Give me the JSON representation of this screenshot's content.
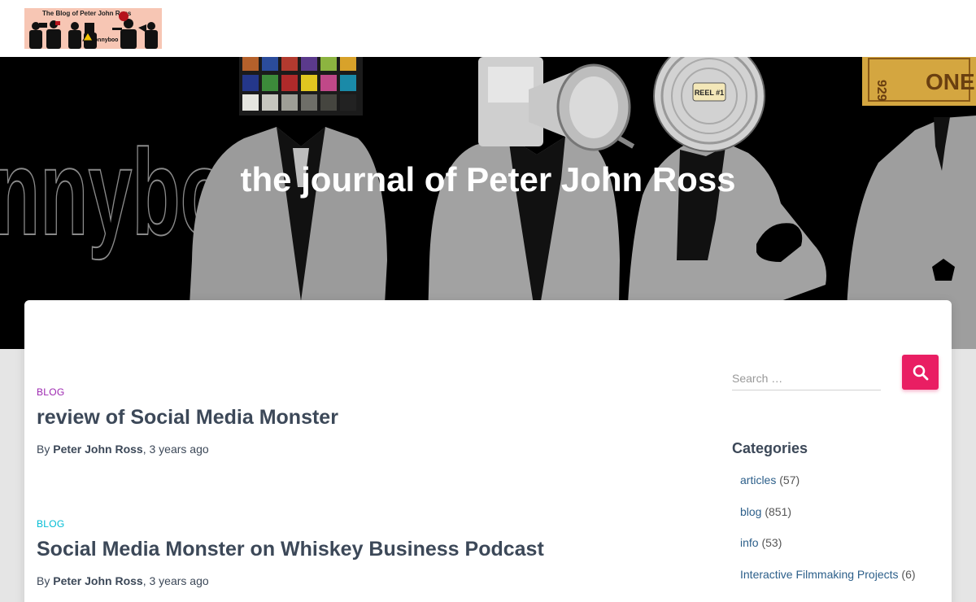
{
  "header": {
    "logo_text": "The Blog of Peter John Ross",
    "logo_badge": "sonnyboo"
  },
  "hero": {
    "title": "the journal of Peter John Ross",
    "bg_word": "nnyboo",
    "reel_label": "REEL #1",
    "ticket_number": "929",
    "ticket_word": "ONE"
  },
  "posts": [
    {
      "category": "BLOG",
      "category_color": "#9c27b0",
      "title": "review of Social Media Monster",
      "by": "By",
      "author": "Peter John Ross",
      "time": ", 3 years ago"
    },
    {
      "category": "BLOG",
      "category_color": "#00bcd4",
      "title": "Social Media Monster on Whiskey Business Podcast",
      "by": "By",
      "author": "Peter John Ross",
      "time": ", 3 years ago"
    }
  ],
  "sidebar": {
    "search": {
      "placeholder": "Search …",
      "button_icon": "search-icon"
    },
    "categories_title": "Categories",
    "categories": [
      {
        "name": "articles",
        "count": " (57)"
      },
      {
        "name": "blog",
        "count": " (851)"
      },
      {
        "name": "info",
        "count": " (53)"
      },
      {
        "name": "Interactive Filmmaking Projects",
        "count": " (6)"
      }
    ]
  },
  "colors": {
    "accent": "#e91e63",
    "heading": "#3c4858",
    "link": "#2c5f8a"
  }
}
